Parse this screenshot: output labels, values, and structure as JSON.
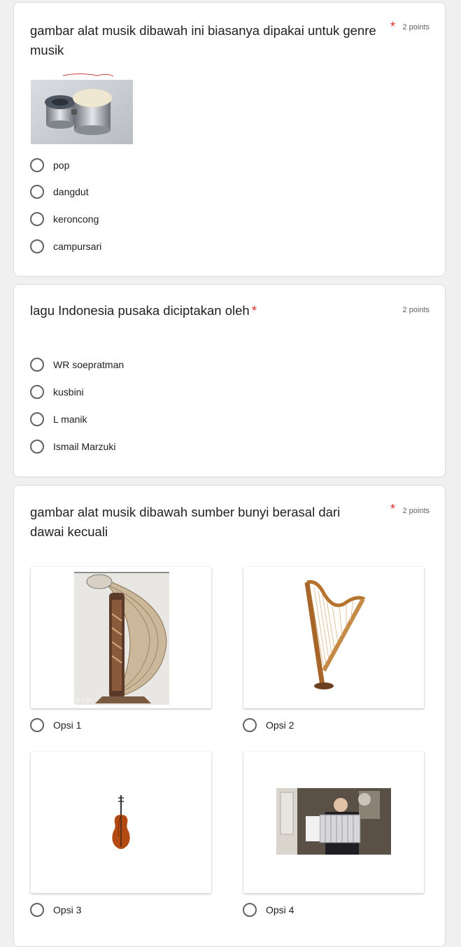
{
  "q1": {
    "title": "gambar alat musik dibawah ini biasanya dipakai untuk genre musik",
    "points": "2 points",
    "options": [
      "pop",
      "dangdut",
      "keroncong",
      "campursari"
    ]
  },
  "q2": {
    "title": "lagu Indonesia pusaka diciptakan oleh",
    "points": "2 points",
    "options": [
      "WR soepratman",
      "kusbini",
      "L manik",
      "Ismail Marzuki"
    ]
  },
  "q3": {
    "title": "gambar alat musik dibawah sumber bunyi berasal dari dawai kecuali",
    "points": "2 points",
    "options": [
      "Opsi 1",
      "Opsi 2",
      "Opsi 3",
      "Opsi 4"
    ],
    "images": [
      "sasando-image",
      "harp-image",
      "violin-image",
      "accordion-player-image"
    ]
  },
  "required_mark": "*",
  "image_caption": "30 × 321"
}
